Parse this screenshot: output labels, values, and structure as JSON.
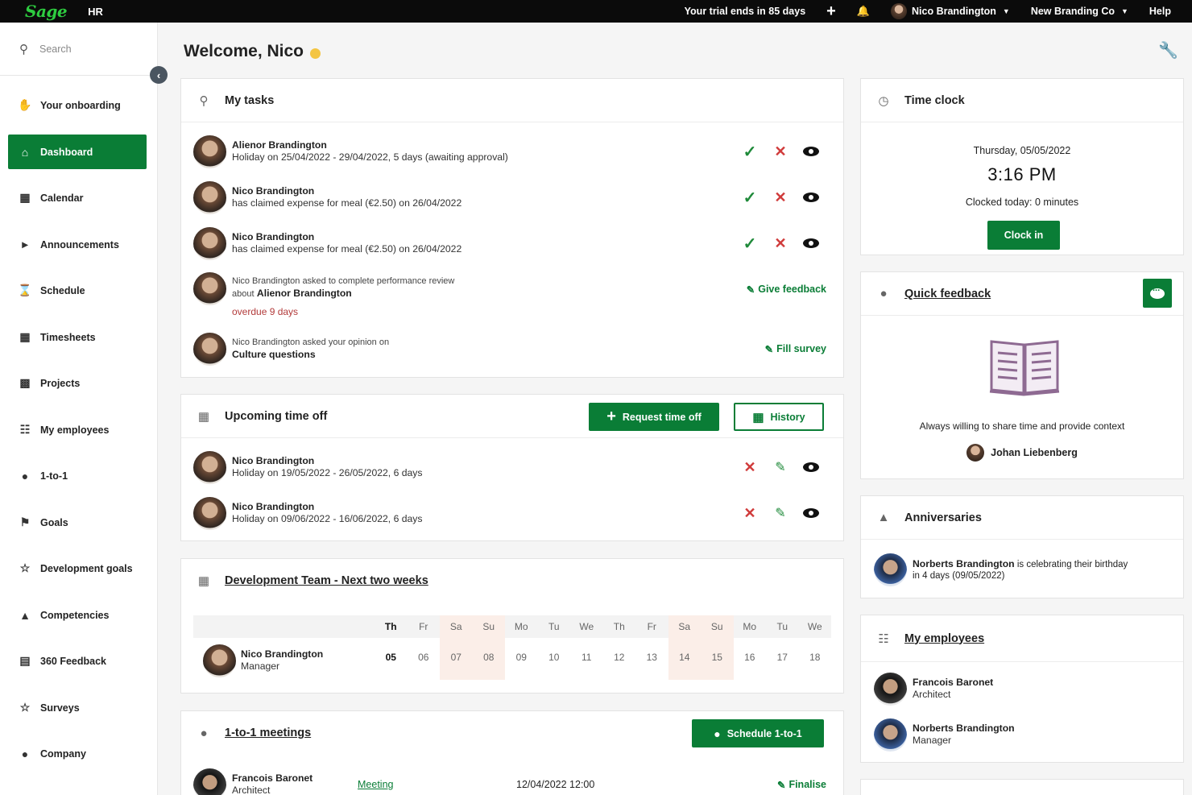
{
  "topbar": {
    "logo": "Sage",
    "app": "HR",
    "trial": "Your trial ends in 85 days",
    "user": "Nico Brandington",
    "company": "New Branding Co",
    "help": "Help"
  },
  "sidebar": {
    "search_placeholder": "Search",
    "items": [
      {
        "label": "Your onboarding",
        "icon": "handshake-icon"
      },
      {
        "label": "Dashboard",
        "icon": "home-icon"
      },
      {
        "label": "Calendar",
        "icon": "calendar-icon"
      },
      {
        "label": "Announcements",
        "icon": "megaphone-icon"
      },
      {
        "label": "Schedule",
        "icon": "hourglass-icon"
      },
      {
        "label": "Timesheets",
        "icon": "table-icon"
      },
      {
        "label": "Projects",
        "icon": "briefcase-icon"
      },
      {
        "label": "My employees",
        "icon": "org-chart-icon"
      },
      {
        "label": "1-to-1",
        "icon": "chat-bubbles-icon"
      },
      {
        "label": "Goals",
        "icon": "flag-icon"
      },
      {
        "label": "Development goals",
        "icon": "trophy-icon"
      },
      {
        "label": "Competencies",
        "icon": "graduation-cap-icon"
      },
      {
        "label": "360 Feedback",
        "icon": "document-icon"
      },
      {
        "label": "Surveys",
        "icon": "star-icon"
      },
      {
        "label": "Company",
        "icon": "users-icon"
      }
    ]
  },
  "welcome": "Welcome, Nico",
  "tasks": {
    "title": "My tasks",
    "items": [
      {
        "name": "Alienor Brandington",
        "detail": "Holiday on 25/04/2022 - 29/04/2022, 5 days (awaiting approval)"
      },
      {
        "name": "Nico Brandington",
        "detail": "has claimed expense for meal (€2.50) on 26/04/2022"
      },
      {
        "name": "Nico Brandington",
        "detail": "has claimed expense for meal (€2.50) on 26/04/2022"
      },
      {
        "line1": "Nico Brandington asked to complete performance review",
        "line2_prefix": "about",
        "line2_name": "Alienor Brandington",
        "overdue": "overdue 9 days",
        "action": "Give feedback"
      },
      {
        "line1": "Nico Brandington asked your opinion on",
        "line2_name": "Culture questions",
        "action": "Fill survey"
      }
    ]
  },
  "timeoff": {
    "title": "Upcoming time off",
    "request_btn": "Request time off",
    "history_btn": "History",
    "items": [
      {
        "name": "Nico Brandington",
        "detail": "Holiday on 19/05/2022 - 26/05/2022, 6 days"
      },
      {
        "name": "Nico Brandington",
        "detail": "Holiday on 09/06/2022 - 16/06/2022, 6 days"
      }
    ]
  },
  "devteam": {
    "title": "Development Team - Next two weeks",
    "days": [
      "Th",
      "Fr",
      "Sa",
      "Su",
      "Mo",
      "Tu",
      "We",
      "Th",
      "Fr",
      "Sa",
      "Su",
      "Mo",
      "Tu",
      "We"
    ],
    "dates": [
      "05",
      "06",
      "07",
      "08",
      "09",
      "10",
      "11",
      "12",
      "13",
      "14",
      "15",
      "16",
      "17",
      "18"
    ],
    "weekend": [
      false,
      false,
      true,
      true,
      false,
      false,
      false,
      false,
      false,
      true,
      true,
      false,
      false,
      false
    ],
    "member": {
      "name": "Nico Brandington",
      "role": "Manager"
    }
  },
  "meetings": {
    "title": "1-to-1 meetings",
    "schedule_btn": "Schedule 1-to-1",
    "row": {
      "name": "Francois Baronet",
      "role": "Architect",
      "type": "Meeting",
      "datetime": "12/04/2022 12:00",
      "action": "Finalise"
    }
  },
  "timeclock": {
    "title": "Time clock",
    "date": "Thursday, 05/05/2022",
    "time": "3:16 PM",
    "clocked": "Clocked today: 0 minutes",
    "btn": "Clock in"
  },
  "quickfeedback": {
    "title": "Quick feedback",
    "quote": "Always willing to share time and provide context",
    "person": "Johan Liebenberg"
  },
  "anniversaries": {
    "title": "Anniversaries",
    "name": "Norberts Brandington",
    "text": "is celebrating their birthday",
    "when": "in 4 days (09/05/2022)"
  },
  "myemployees": {
    "title": "My employees",
    "items": [
      {
        "name": "Francois Baronet",
        "role": "Architect"
      },
      {
        "name": "Norberts Brandington",
        "role": "Manager"
      }
    ]
  },
  "colors": {
    "brand_green": "#0a7d36",
    "danger": "#d03a3a"
  }
}
